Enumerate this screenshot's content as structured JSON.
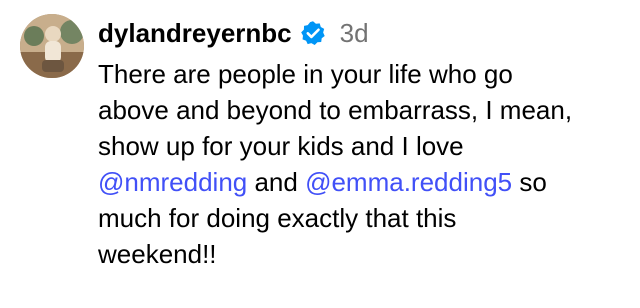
{
  "comment": {
    "username": "dylandreyernbc",
    "timestamp": "3d",
    "avatar_icon": "profile-photo",
    "verified_icon": "verified-badge-icon",
    "colors": {
      "verified": "#0095f6",
      "mention": "#4150f7",
      "timestamp": "#737373"
    },
    "lines": [
      {
        "segments": [
          {
            "text": "There are people in your life who go"
          }
        ]
      },
      {
        "segments": [
          {
            "text": "above and beyond to embarrass, I mean,"
          }
        ]
      },
      {
        "segments": [
          {
            "text": "show up for your kids and I love"
          }
        ]
      },
      {
        "segments": [
          {
            "text": "@nmredding",
            "mention": true
          },
          {
            "text": " and "
          },
          {
            "text": "@emma.redding5",
            "mention": true
          },
          {
            "text": " so"
          }
        ]
      },
      {
        "segments": [
          {
            "text": "much for doing exactly that this"
          }
        ]
      },
      {
        "segments": [
          {
            "text": "weekend!!"
          }
        ]
      }
    ]
  }
}
